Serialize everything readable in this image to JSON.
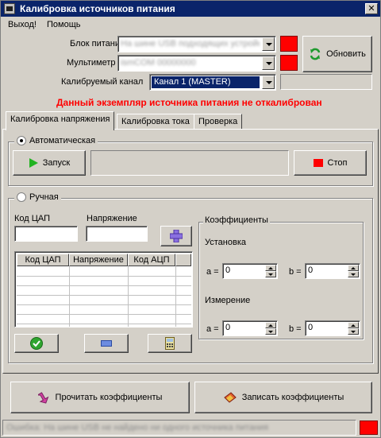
{
  "window": {
    "title": "Калибровка источников питания",
    "close_glyph": "✕"
  },
  "menu": {
    "items": [
      "Выход!",
      "Помощь"
    ]
  },
  "device": {
    "psu_label": "Блок питания",
    "psu_value": "На шине USB подходящих устройств",
    "meter_label": "Мультиметр",
    "meter_value": "ismCOM 00000000",
    "channel_label": "Калибруемый канал",
    "channel_value": "Канал 1 (MASTER)",
    "refresh_label": "Обновить"
  },
  "warning": "Данный экземпляр источника питания не откалиброван",
  "tabs": [
    "Калибровка напряжения",
    "Калибровка тока",
    "Проверка"
  ],
  "auto": {
    "title": "Автоматическая",
    "start_label": "Запуск",
    "stop_label": "Стоп"
  },
  "manual": {
    "title": "Ручная",
    "dac_label": "Код ЦАП",
    "voltage_label": "Напряжение",
    "columns": [
      "Код ЦАП",
      "Напряжение",
      "Код АЦП"
    ]
  },
  "coef": {
    "title": "Коэффициенты",
    "setting_label": "Установка",
    "measure_label": "Измерение",
    "a_label": "a =",
    "b_label": "b =",
    "set_a": "0",
    "set_b": "0",
    "meas_a": "0",
    "meas_b": "0"
  },
  "bottom": {
    "read_label": "Прочитать коэффициенты",
    "write_label": "Записать коэффициенты"
  },
  "status": {
    "text": "Ошибка: На шине USB не найдено ни одного источника питания"
  },
  "colors": {
    "indicator_red": "#ff0000",
    "title_blue": "#0a246a",
    "warning_red": "#ff0000"
  }
}
